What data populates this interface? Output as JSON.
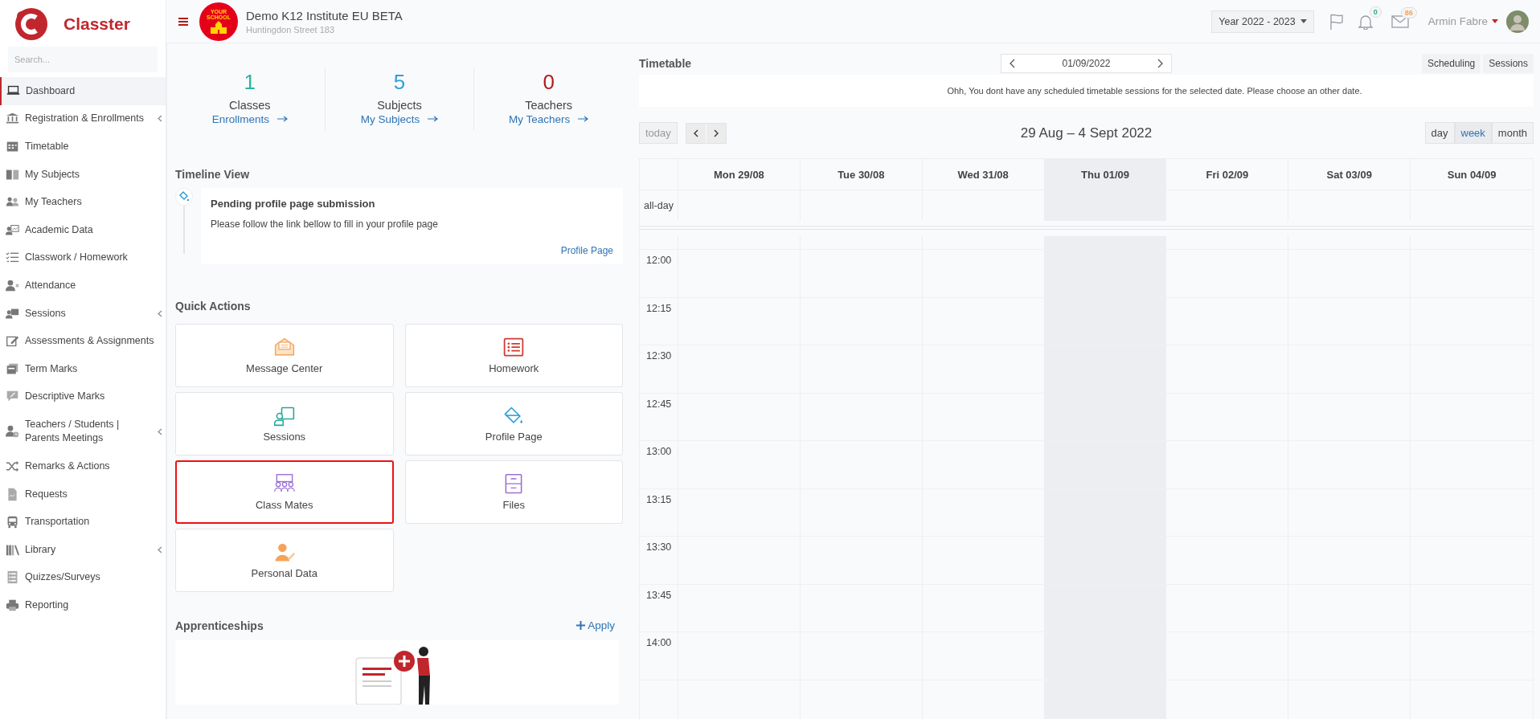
{
  "sidebar": {
    "brand": "Classter",
    "search": {
      "placeholder": "Search..."
    },
    "items": [
      {
        "label": "Dashboard",
        "selected": true,
        "expandable": false
      },
      {
        "label": "Registration & Enrollments",
        "selected": false,
        "expandable": true
      },
      {
        "label": "Timetable",
        "selected": false,
        "expandable": false
      },
      {
        "label": "My Subjects",
        "selected": false,
        "expandable": false
      },
      {
        "label": "My Teachers",
        "selected": false,
        "expandable": false
      },
      {
        "label": "Academic Data",
        "selected": false,
        "expandable": false
      },
      {
        "label": "Classwork / Homework",
        "selected": false,
        "expandable": false
      },
      {
        "label": "Attendance",
        "selected": false,
        "expandable": false
      },
      {
        "label": "Sessions",
        "selected": false,
        "expandable": true
      },
      {
        "label": "Assessments & Assignments",
        "selected": false,
        "expandable": false
      },
      {
        "label": "Term Marks",
        "selected": false,
        "expandable": false
      },
      {
        "label": "Descriptive Marks",
        "selected": false,
        "expandable": false
      },
      {
        "label": "Teachers / Students | Parents Meetings",
        "selected": false,
        "expandable": true
      },
      {
        "label": "Remarks & Actions",
        "selected": false,
        "expandable": false
      },
      {
        "label": "Requests",
        "selected": false,
        "expandable": false
      },
      {
        "label": "Transportation",
        "selected": false,
        "expandable": false
      },
      {
        "label": "Library",
        "selected": false,
        "expandable": true
      },
      {
        "label": "Quizzes/Surveys",
        "selected": false,
        "expandable": false
      },
      {
        "label": "Reporting",
        "selected": false,
        "expandable": false
      }
    ]
  },
  "header": {
    "school": {
      "logo_text": "YOUR SCHOOL",
      "name": "Demo K12 Institute EU BETA",
      "address": "Huntingdon Street 183"
    },
    "year_selector": "Year 2022 - 2023",
    "notifications": {
      "count": "0"
    },
    "messages": {
      "count": "86"
    },
    "user": {
      "name": "Armin Fabre"
    }
  },
  "stats": [
    {
      "value": "1",
      "label": "Classes",
      "link": "Enrollments",
      "color": "#2bb3a3"
    },
    {
      "value": "5",
      "label": "Subjects",
      "link": "My Subjects",
      "color": "#2f9fd8"
    },
    {
      "value": "0",
      "label": "Teachers",
      "link": "My Teachers",
      "color": "#b01c1c"
    }
  ],
  "timeline": {
    "title": "Timeline View",
    "items": [
      {
        "title": "Pending profile page submission",
        "text": "Please follow the link bellow to fill in your profile page",
        "link": "Profile Page"
      }
    ]
  },
  "quick_actions": {
    "title": "Quick Actions",
    "tiles": [
      {
        "label": "Message Center",
        "highlighted": false
      },
      {
        "label": "Homework",
        "highlighted": false
      },
      {
        "label": "Sessions",
        "highlighted": false
      },
      {
        "label": "Profile Page",
        "highlighted": false
      },
      {
        "label": "Class Mates",
        "highlighted": true
      },
      {
        "label": "Files",
        "highlighted": false
      },
      {
        "label": "Personal Data",
        "highlighted": false
      }
    ]
  },
  "apprenticeships": {
    "title": "Apprenticeships",
    "action": "Apply"
  },
  "timetable": {
    "title": "Timetable",
    "date": "01/09/2022",
    "buttons": [
      "Scheduling",
      "Sessions"
    ],
    "message": "Ohh, You dont have any scheduled timetable sessions for the selected date. Please choose an other date.",
    "calendar": {
      "today_button": "today",
      "range": "29 Aug – 4 Sept 2022",
      "views": [
        {
          "label": "day",
          "selected": false
        },
        {
          "label": "week",
          "selected": true
        },
        {
          "label": "month",
          "selected": false
        }
      ],
      "days": [
        {
          "label": "Mon 29/08",
          "today": false
        },
        {
          "label": "Tue 30/08",
          "today": false
        },
        {
          "label": "Wed 31/08",
          "today": false
        },
        {
          "label": "Thu 01/09",
          "today": true
        },
        {
          "label": "Fri 02/09",
          "today": false
        },
        {
          "label": "Sat 03/09",
          "today": false
        },
        {
          "label": "Sun 04/09",
          "today": false
        }
      ],
      "all_day_label": "all-day",
      "times": [
        "12:00",
        "12:15",
        "12:30",
        "12:45",
        "13:00",
        "13:15",
        "13:30",
        "13:45",
        "14:00"
      ]
    }
  }
}
